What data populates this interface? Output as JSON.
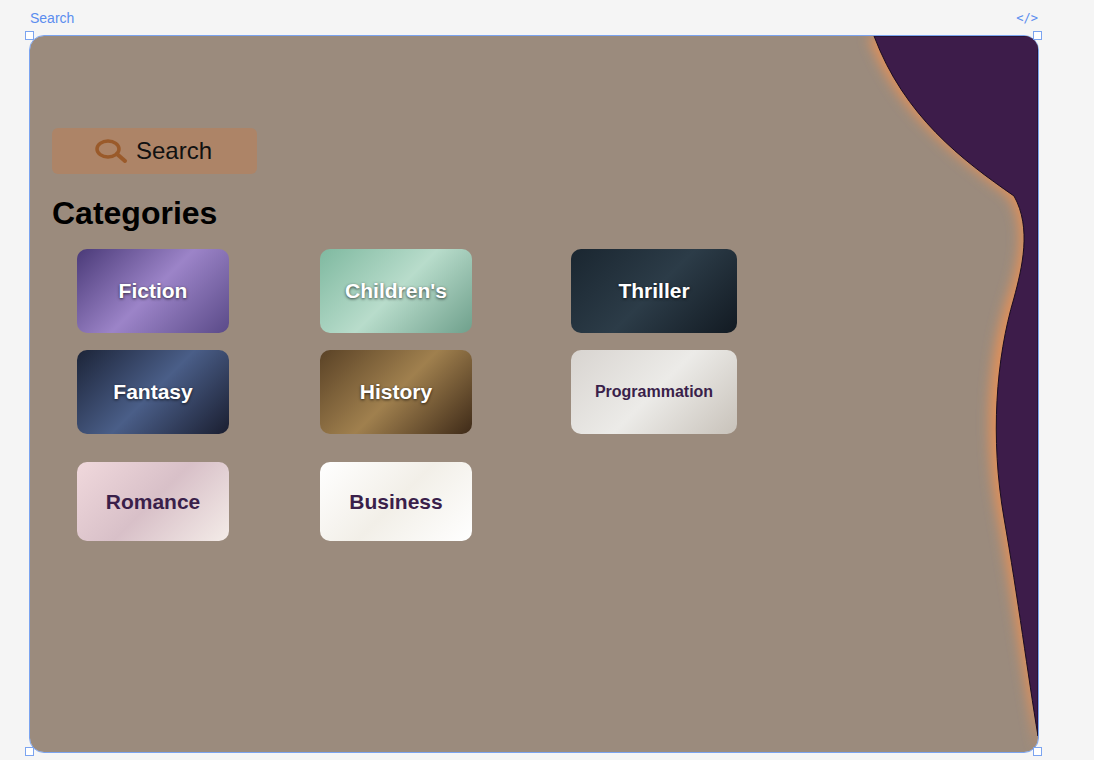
{
  "window": {
    "title": "Search",
    "code_toggle": "</>"
  },
  "search_button": {
    "label": "Search"
  },
  "heading": "Categories",
  "categories": [
    {
      "label": "Fiction",
      "color": "#ffffff"
    },
    {
      "label": "Children's",
      "color": "#ffffff"
    },
    {
      "label": "Thriller",
      "color": "#ffffff"
    },
    {
      "label": "Fantasy",
      "color": "#ffffff"
    },
    {
      "label": "History",
      "color": "#ffffff"
    },
    {
      "label": "Programmation",
      "color": "#3a1f4a"
    },
    {
      "label": "Romance",
      "color": "#3a1f4a"
    },
    {
      "label": "Business",
      "color": "#3a1f4a"
    }
  ]
}
